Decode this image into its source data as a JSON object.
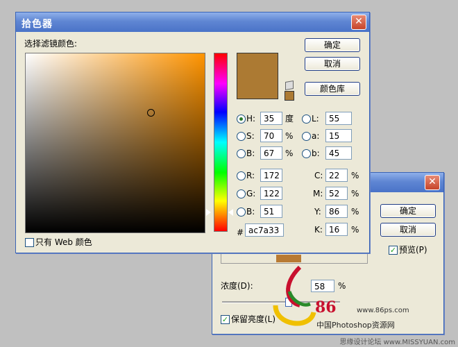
{
  "picker": {
    "title": "拾色器",
    "close": "✕",
    "label": "选择滤镜颜色:",
    "ok": "确定",
    "cancel": "取消",
    "library": "颜色库",
    "current_color": "#ac7a33",
    "hue_color": "#ff9400",
    "fields": {
      "H": {
        "label": "H:",
        "value": "35",
        "unit": "度"
      },
      "S": {
        "label": "S:",
        "value": "70",
        "unit": "%"
      },
      "Bv": {
        "label": "B:",
        "value": "67",
        "unit": "%"
      },
      "R": {
        "label": "R:",
        "value": "172"
      },
      "G": {
        "label": "G:",
        "value": "122"
      },
      "B": {
        "label": "B:",
        "value": "51"
      },
      "L": {
        "label": "L:",
        "value": "55"
      },
      "a": {
        "label": "a:",
        "value": "15"
      },
      "b": {
        "label": "b:",
        "value": "45"
      },
      "C": {
        "label": "C:",
        "value": "22",
        "unit": "%"
      },
      "M": {
        "label": "M:",
        "value": "52",
        "unit": "%"
      },
      "Y": {
        "label": "Y:",
        "value": "86",
        "unit": "%"
      },
      "K": {
        "label": "K:",
        "value": "16",
        "unit": "%"
      },
      "hex": {
        "label": "#",
        "value": "ac7a33"
      }
    },
    "web_only": "只有 Web 颜色",
    "selected_radio": "H"
  },
  "filter": {
    "close": "✕",
    "ok": "确定",
    "cancel": "取消",
    "preview": "预览(P)",
    "density_label": "浓度(D):",
    "density_value": "58",
    "density_unit": "%",
    "preserve": "保留亮度(L)",
    "swatch_color": "#b87a33"
  },
  "watermark": {
    "number": "86",
    "site": "www.86ps.com",
    "tagline": "中国Photoshop资源网",
    "footer": "思缘设计论坛  www.MISSYUAN.com"
  }
}
